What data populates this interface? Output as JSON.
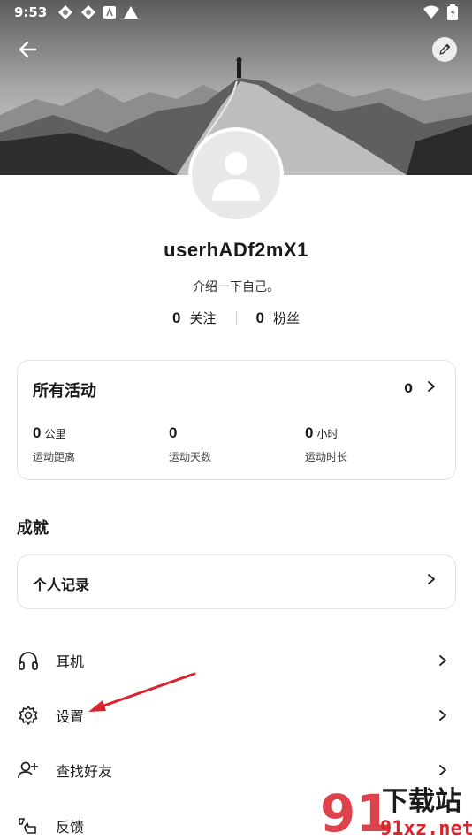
{
  "status_bar": {
    "time": "9:53"
  },
  "profile": {
    "username": "userhADf2mX1",
    "bio": "介绍一下自己。",
    "following_count": "0",
    "following_label": "关注",
    "followers_count": "0",
    "followers_label": "粉丝"
  },
  "activity": {
    "title": "所有活动",
    "count": "0",
    "stats": [
      {
        "value": "0",
        "unit": "公里",
        "label": "运动距离"
      },
      {
        "value": "0",
        "unit": "",
        "label": "运动天数"
      },
      {
        "value": "0",
        "unit": "小时",
        "label": "运动时长"
      }
    ]
  },
  "achievements": {
    "section_title": "成就",
    "records_label": "个人记录"
  },
  "menu": [
    {
      "label": "耳机",
      "icon": "headphones-icon"
    },
    {
      "label": "设置",
      "icon": "gear-icon"
    },
    {
      "label": "查找好友",
      "icon": "add-friend-icon"
    },
    {
      "label": "反馈",
      "icon": "feedback-icon"
    }
  ],
  "watermark": {
    "brand": "下载站",
    "domain": "91xz.net",
    "mark": "91"
  },
  "colors": {
    "accent_red": "#d9232d",
    "card_border": "#e2e2e2"
  }
}
